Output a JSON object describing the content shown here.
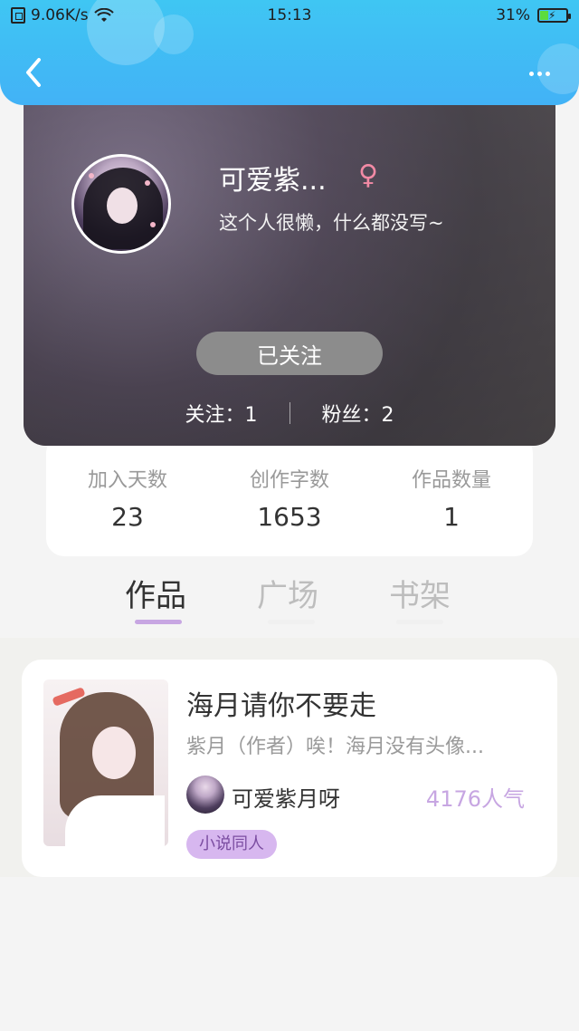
{
  "status_bar": {
    "network_speed": "9.06K/s",
    "time": "15:13",
    "battery": "31%",
    "battery_level": 0.31
  },
  "profile": {
    "nickname": "可爱紫...",
    "gender_symbol": "♀",
    "signature": "这个人很懒，什么都没写~",
    "follow_button": "已关注",
    "following": "关注：1",
    "fans": "粉丝：2"
  },
  "stats": [
    {
      "label": "加入天数",
      "value": "23"
    },
    {
      "label": "创作字数",
      "value": "1653"
    },
    {
      "label": "作品数量",
      "value": "1"
    }
  ],
  "tabs": [
    {
      "label": "作品",
      "active": true
    },
    {
      "label": "广场",
      "active": false
    },
    {
      "label": "书架",
      "active": false
    }
  ],
  "works": [
    {
      "title": "海月请你不要走",
      "desc": "紫月（作者）唉！海月没有头像...",
      "author": "可爱紫月呀",
      "popularity": "4176人气",
      "tag": "小说同人"
    }
  ],
  "colors": {
    "header": "#42b2f6",
    "accent_purple": "#c7a6e2",
    "tag_bg": "#d7b7ef"
  },
  "icons": {
    "back": "back-icon",
    "more": "more-icon",
    "gender": "female-icon",
    "wifi": "wifi-icon",
    "battery": "battery-icon",
    "sim": "sim-icon"
  }
}
